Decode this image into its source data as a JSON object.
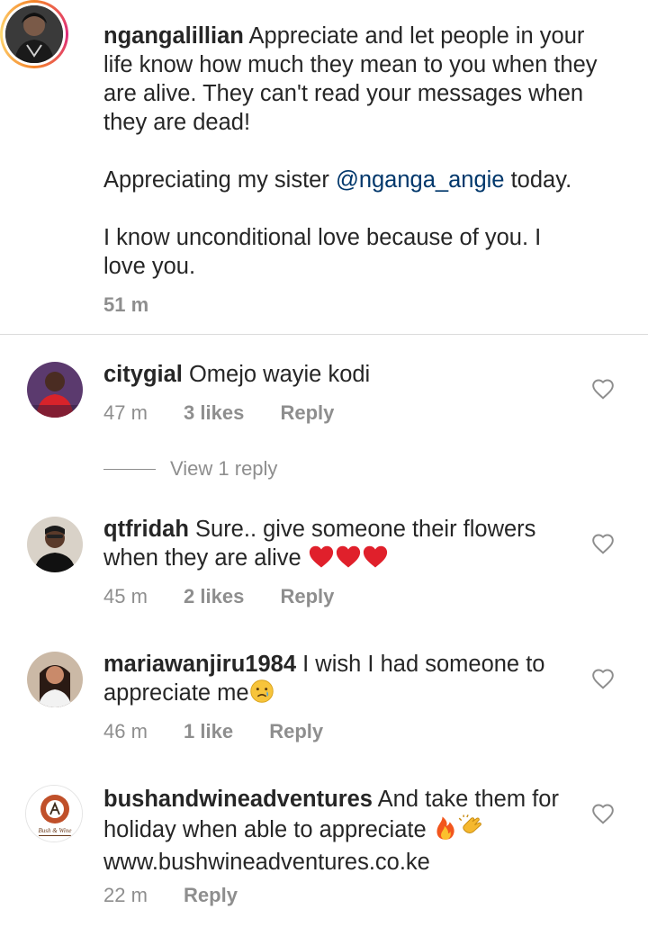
{
  "caption": {
    "username": "ngangalillian",
    "text_p1": "Appreciate and let people in your life know how much they mean to you when they are alive. They can't read your messages when they are dead!",
    "text_p2_before": "Appreciating my sister ",
    "text_p2_mention": "@nganga_angie",
    "text_p2_after": " today.",
    "text_p3": "I know unconditional love because of you. I love you.",
    "time": "51 m"
  },
  "comments": [
    {
      "username": "citygial",
      "text": "Omejo wayie kodi",
      "time": "47 m",
      "likes": "3 likes",
      "reply": "Reply",
      "view_replies": "View 1 reply"
    },
    {
      "username": "qtfridah",
      "text": "Sure.. give someone their flowers when they are alive ",
      "emojis": [
        "red-heart",
        "red-heart",
        "red-heart"
      ],
      "time": "45 m",
      "likes": "2 likes",
      "reply": "Reply"
    },
    {
      "username": "mariawanjiru1984",
      "text": "I wish I had someone to appreciate me",
      "emojis": [
        "crying-face"
      ],
      "time": "46 m",
      "likes": "1 like",
      "reply": "Reply"
    },
    {
      "username": "bushandwineadventures",
      "text_before": "And take them for holiday when able to appreciate ",
      "emojis": [
        "fire",
        "clapping-hands"
      ],
      "link": "www.bushwineadventures.co.ke",
      "time": "22 m",
      "reply": "Reply",
      "logo_text": "Bush & Wine"
    }
  ],
  "colors": {
    "text": "#262626",
    "secondary": "#8e8e8e",
    "mention": "#00376b",
    "divider": "#dbdbdb"
  }
}
